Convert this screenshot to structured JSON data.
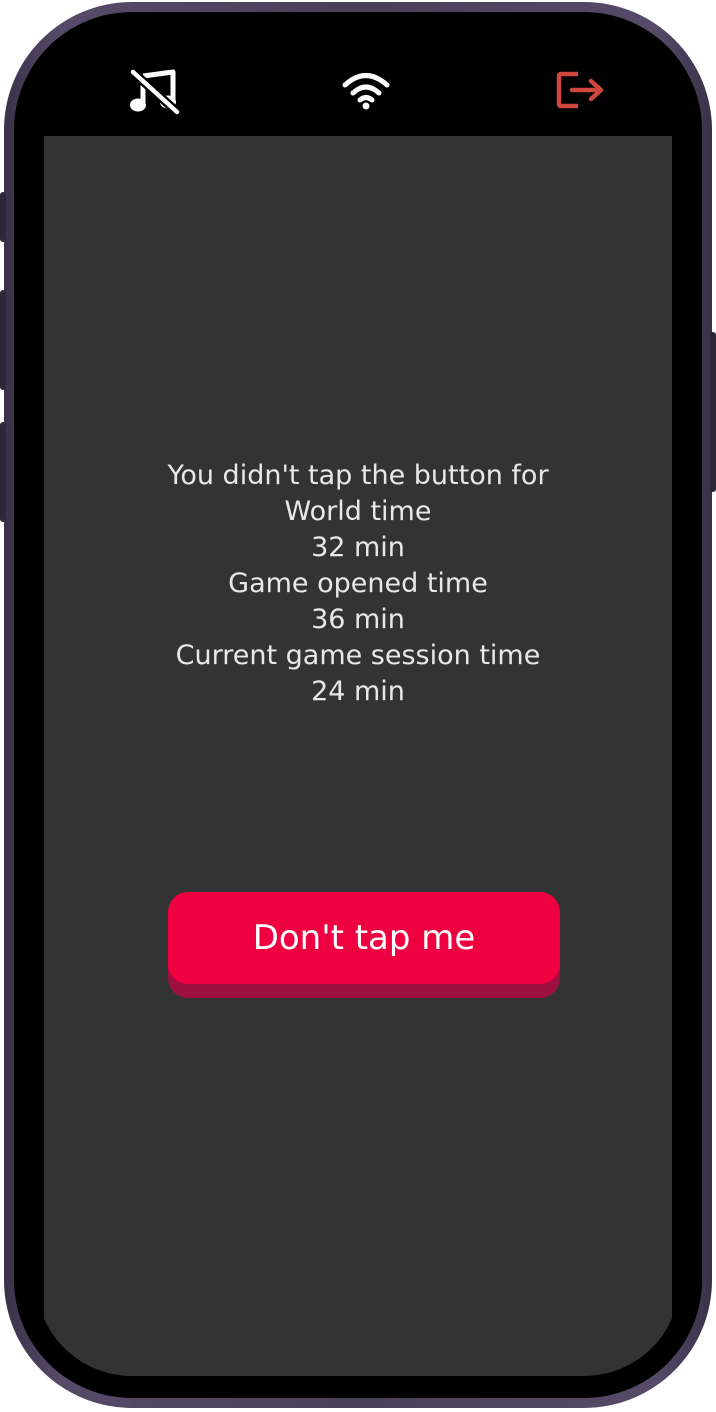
{
  "toolbar": {
    "music_icon": "music-off-icon",
    "wifi_icon": "wifi-icon",
    "exit_icon": "exit-icon",
    "exit_color": "#d0473f"
  },
  "info": {
    "line1": "You didn't tap the button for",
    "world_time_label": "World time",
    "world_time_value": "32 min",
    "game_opened_label": "Game opened time",
    "game_opened_value": "36 min",
    "session_label": "Current game session time",
    "session_value": "24 min"
  },
  "button": {
    "label": "Don't tap me",
    "color": "#ef0041"
  }
}
